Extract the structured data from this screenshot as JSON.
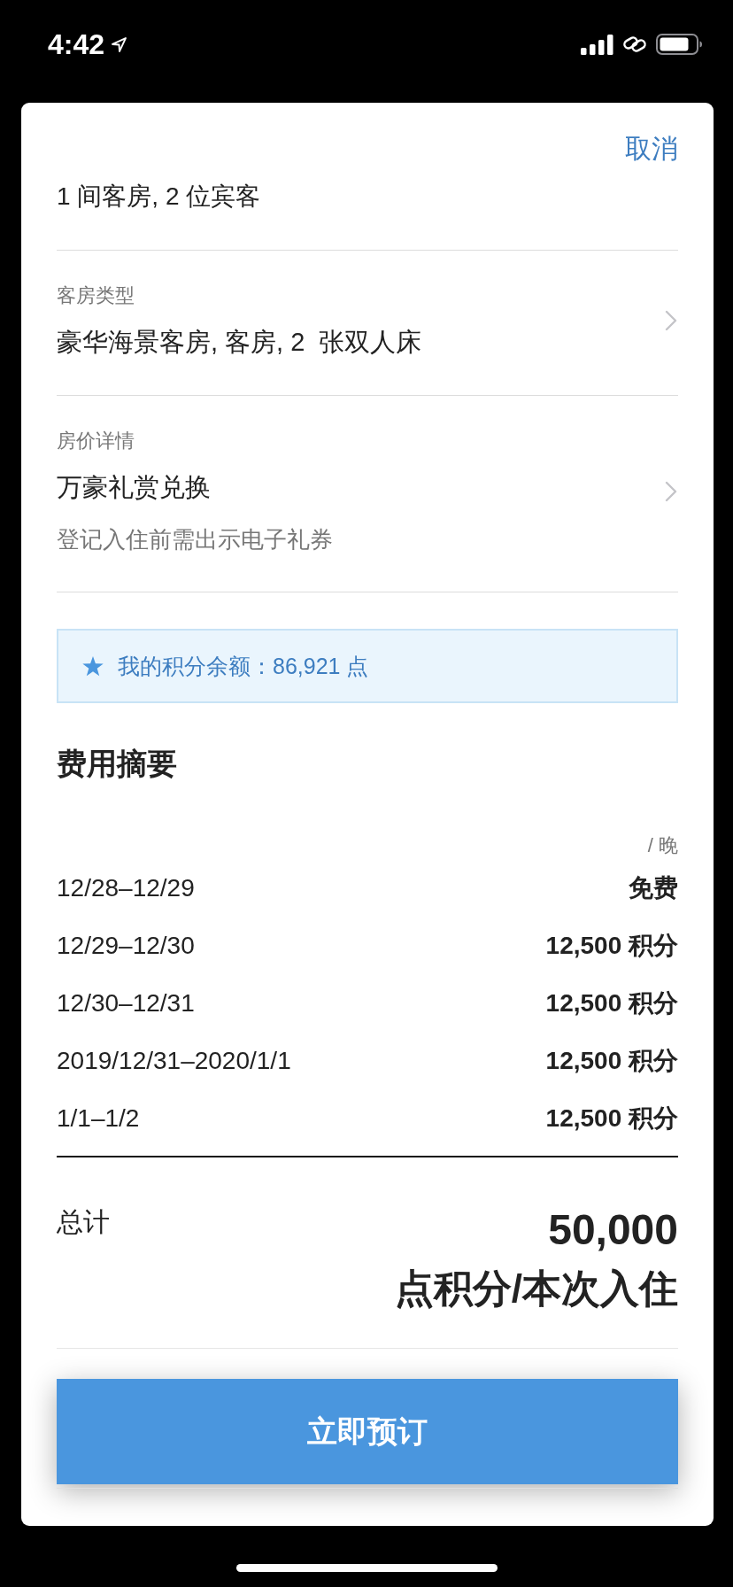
{
  "status_bar": {
    "time": "4:42"
  },
  "header": {
    "cancel": "取消",
    "stay": "1 间客房, 2 位宾客"
  },
  "details": [
    {
      "label": "客房类型",
      "value": "豪华海景客房, 客房, 2  张双人床"
    },
    {
      "label": "房价详情",
      "value": "万豪礼赏兑换",
      "note": "登记入住前需出示电子礼券"
    }
  ],
  "points_balance": {
    "text": "我的积分余额：86,921 点"
  },
  "cost_summary": {
    "title": "费用摘要",
    "per_night": "/ 晚",
    "nights": [
      {
        "dates": "12/28–12/29",
        "price": "免费"
      },
      {
        "dates": "12/29–12/30",
        "price": "12,500 积分"
      },
      {
        "dates": "12/30–12/31",
        "price": "12,500 积分"
      },
      {
        "dates": "2019/12/31–2020/1/1",
        "price": "12,500 积分"
      },
      {
        "dates": "1/1–1/2",
        "price": "12,500 积分"
      }
    ],
    "total": {
      "label": "总计",
      "amount": "50,000",
      "unit": "点积分/本次入住"
    }
  },
  "book_button": {
    "label": "立即预订"
  }
}
